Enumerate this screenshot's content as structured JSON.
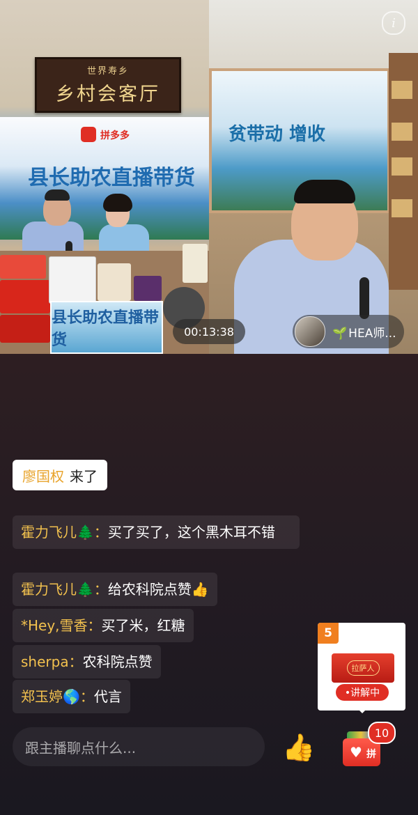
{
  "video": {
    "left_sign": {
      "small": "世界寿乡",
      "big": "乡村会客厅"
    },
    "left_banner_title": "县长助农直播带货",
    "left_banner_brand": "拼多多",
    "product_label": "县长助农直播带货",
    "right_banner_title": "贫带动 增收",
    "timer": "00:13:38",
    "streamer": {
      "name": "HEA师...",
      "leaf": "🌱"
    },
    "info_icon": "info-icon"
  },
  "join_notice": {
    "name": "廖国权",
    "text": "来了"
  },
  "chat": [
    {
      "name": "霍力飞儿🌲：",
      "text": "买了买了，这个黑木耳不错"
    },
    {
      "name": "霍力飞儿🌲：",
      "text": "给农科院点赞👍"
    },
    {
      "name": "*Hey,雪香：",
      "text": "买了米，红糖"
    },
    {
      "name": "sherpa：",
      "text": "农科院点赞"
    },
    {
      "name": "郑玉婷🌎：",
      "text": "代言"
    }
  ],
  "input": {
    "placeholder": "跟主播聊点什么..."
  },
  "like_icon": "👍",
  "product_card": {
    "index": "5",
    "thumb_text": "拉萨人",
    "explain": "•讲解中"
  },
  "cart": {
    "badge": "10",
    "icon": "shopping-bag-icon",
    "pin": "拼"
  },
  "colors": {
    "accent": "#e02e24",
    "name_color": "#f2c14e",
    "badge_orange": "#f07f1f"
  }
}
